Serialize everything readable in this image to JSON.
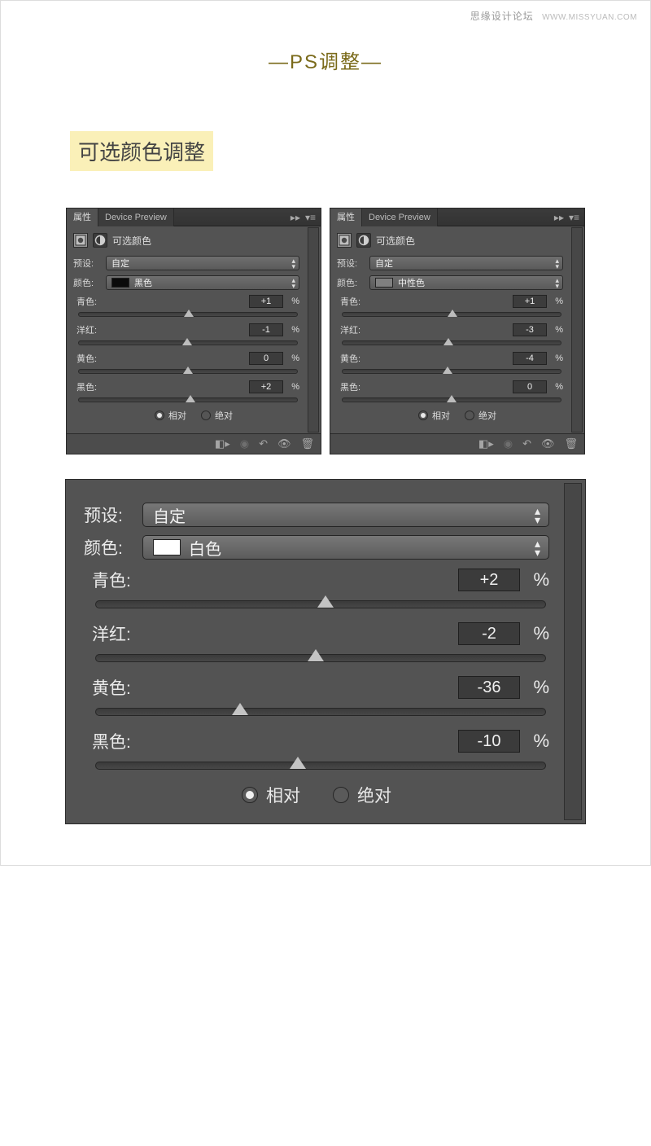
{
  "watermark": {
    "site": "思缘设计论坛",
    "url": "WWW.MISSYUAN.COM"
  },
  "page_title": "—PS调整—",
  "section_label": "可选颜色调整",
  "labels": {
    "tab_properties": "属性",
    "tab_device_preview": "Device Preview",
    "adjustment_name": "可选颜色",
    "preset": "预设:",
    "color": "颜色:",
    "cyan": "青色:",
    "magenta": "洋红:",
    "yellow": "黄色:",
    "black": "黑色:",
    "percent": "%",
    "relative": "相对",
    "absolute": "绝对"
  },
  "panel_a": {
    "preset_value": "自定",
    "color_value": "黑色",
    "swatch": "#0b0b0b",
    "sliders": {
      "cyan": "+1",
      "magenta": "-1",
      "yellow": "0",
      "black": "+2"
    },
    "mode": "relative"
  },
  "panel_b": {
    "preset_value": "自定",
    "color_value": "中性色",
    "swatch": "#808080",
    "sliders": {
      "cyan": "+1",
      "magenta": "-3",
      "yellow": "-4",
      "black": "0"
    },
    "mode": "relative"
  },
  "panel_c": {
    "preset_value": "自定",
    "color_value": "白色",
    "swatch": "#ffffff",
    "sliders": {
      "cyan": "+2",
      "magenta": "-2",
      "yellow": "-36",
      "black": "-10"
    },
    "mode": "relative"
  }
}
